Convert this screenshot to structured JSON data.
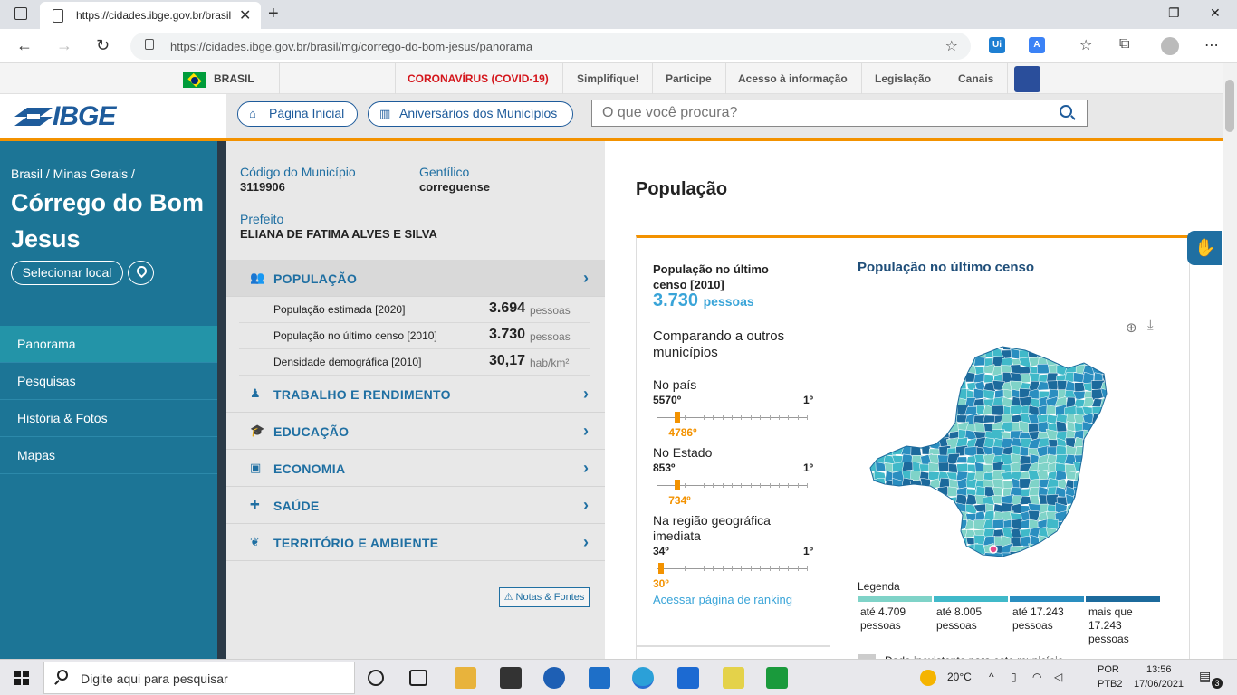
{
  "browser": {
    "tab_title": "https://cidades.ibge.gov.br/brasil",
    "url": "https://cidades.ibge.gov.br/brasil/mg/corrego-do-bom-jesus/panorama",
    "ext1": "Ui"
  },
  "govbar": {
    "country": "BRASIL",
    "links": [
      "CORONAVÍRUS (COVID-19)",
      "Simplifique!",
      "Participe",
      "Acesso à informação",
      "Legislação",
      "Canais"
    ]
  },
  "header": {
    "logo": "IBGE",
    "home_label": "Página Inicial",
    "anniv_label": "Aniversários dos Municípios",
    "search_placeholder": "O que você procura?"
  },
  "sidebar": {
    "breadcrumb": "Brasil / Minas Gerais /",
    "city": "Córrego do Bom Jesus",
    "select_label": "Selecionar local",
    "nav": [
      "Panorama",
      "Pesquisas",
      "História & Fotos",
      "Mapas"
    ]
  },
  "municipio": {
    "codigo_label": "Código do Município",
    "codigo": "3119906",
    "gentilico_label": "Gentílico",
    "gentilico": "correguense",
    "prefeito_label": "Prefeito",
    "prefeito": "ELIANA DE FATIMA ALVES E SILVA"
  },
  "sections": [
    "POPULAÇÃO",
    "TRABALHO E RENDIMENTO",
    "EDUCAÇÃO",
    "ECONOMIA",
    "SAÚDE",
    "TERRITÓRIO E AMBIENTE"
  ],
  "populacao_rows": [
    {
      "label": "População estimada [2020]",
      "value": "3.694",
      "unit": "pessoas"
    },
    {
      "label": "População no último censo [2010]",
      "value": "3.730",
      "unit": "pessoas"
    },
    {
      "label": "Densidade demográfica [2010]",
      "value": "30,17",
      "unit": "hab/km²"
    }
  ],
  "notas_label": "Notas & Fontes",
  "content": {
    "title": "População",
    "pop_title": "População no último censo [2010]",
    "pop_value": "3.730",
    "pop_unit": "pessoas",
    "compare": "Comparando a outros municípios",
    "ranks": [
      {
        "title": "No país",
        "low": "5570º",
        "high": "1º",
        "pos": "4786º",
        "fraction": 0.141
      },
      {
        "title": "No Estado",
        "low": "853º",
        "high": "1º",
        "pos": "734º",
        "fraction": 0.14
      },
      {
        "title": "Na região geográfica imediata",
        "low": "34º",
        "high": "1º",
        "pos": "30º",
        "fraction": 0.03
      }
    ],
    "ranking_link": "Acessar página de ranking",
    "map_title": "População no último censo",
    "legend_title": "Legenda",
    "legend": [
      {
        "text": "até 4.709 pessoas",
        "color": "#7fd3c8"
      },
      {
        "text": "até 8.005 pessoas",
        "color": "#40b9c9"
      },
      {
        "text": "até 17.243 pessoas",
        "color": "#2a8ec0"
      },
      {
        "text": "mais que 17.243 pessoas",
        "color": "#1c6a9c"
      }
    ],
    "nodata": "Dado inexistente para este município"
  },
  "taskbar": {
    "search_text": "Digite aqui para pesquisar",
    "weather": "20°C",
    "lang1": "POR",
    "lang2": "PTB2",
    "time": "13:56",
    "date": "17/06/2021",
    "notif": "3"
  }
}
